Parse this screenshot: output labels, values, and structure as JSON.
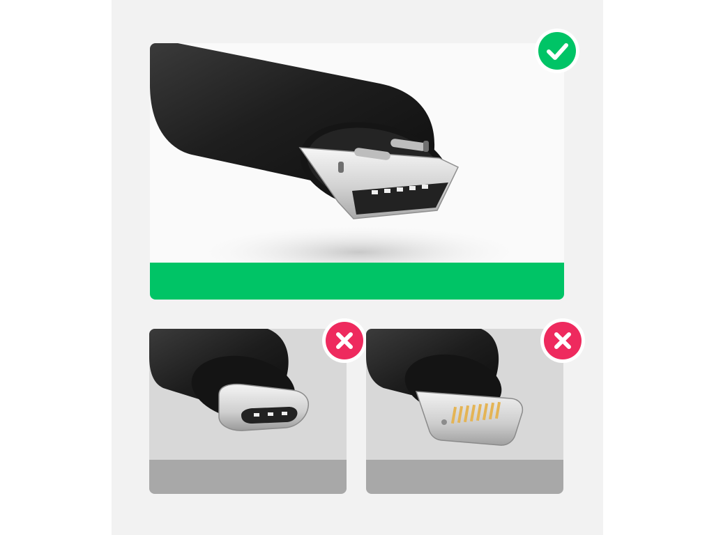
{
  "colors": {
    "page_background": "#ffffff",
    "stage_background": "#f2f2f2",
    "accent_green": "#00c466",
    "accent_red": "#ee2a5e",
    "band_gray": "#a8a8a8",
    "connector_black": "#1b1b1b",
    "metal_silver": "#d9d9d9",
    "contact_gold": "#e4b455"
  },
  "compatible": {
    "connector": "micro-usb-connector",
    "status_icon": "checkmark-icon",
    "compatible": true
  },
  "not_compatible": [
    {
      "connector": "usb-c-connector",
      "status_icon": "cross-icon",
      "compatible": false
    },
    {
      "connector": "lightning-connector",
      "status_icon": "cross-icon",
      "compatible": false
    }
  ]
}
